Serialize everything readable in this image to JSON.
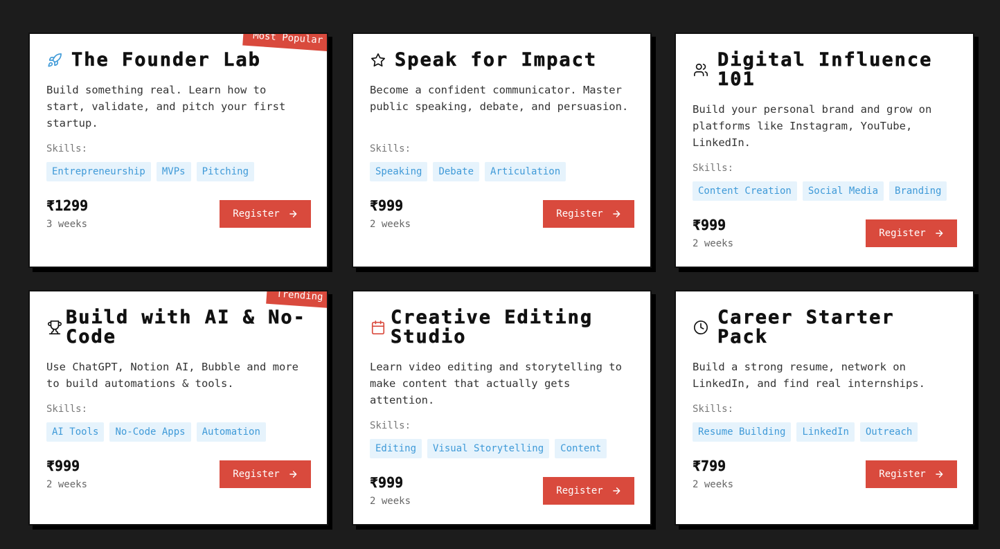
{
  "colors": {
    "accent": "#d94a3d",
    "tag_bg": "#e6f3fc",
    "tag_text": "#3f9ad8",
    "background": "#1c1c1c"
  },
  "skills_label": "Skills:",
  "register_label": "Register",
  "courses": [
    {
      "title": "The Founder Lab",
      "icon": "rocket-icon",
      "ribbon": "Most Popular",
      "description": "Build something real. Learn how to start, validate, and pitch your first startup.",
      "skills": [
        "Entrepreneurship",
        "MVPs",
        "Pitching"
      ],
      "price": "₹1299",
      "duration": "3 weeks"
    },
    {
      "title": "Speak for Impact",
      "icon": "star-icon",
      "description": "Become a confident communicator. Master public speaking, debate, and persuasion.",
      "skills": [
        "Speaking",
        "Debate",
        "Articulation"
      ],
      "price": "₹999",
      "duration": "2 weeks"
    },
    {
      "title": "Digital Influence 101",
      "icon": "users-icon",
      "description": "Build your personal brand and grow on platforms like Instagram, YouTube, LinkedIn.",
      "skills": [
        "Content Creation",
        "Social Media",
        "Branding"
      ],
      "price": "₹999",
      "duration": "2 weeks"
    },
    {
      "title": "Build with AI & No-Code",
      "icon": "trophy-icon",
      "ribbon": "Trending",
      "description": "Use ChatGPT, Notion AI, Bubble and more to build automations & tools.",
      "skills": [
        "AI Tools",
        "No-Code Apps",
        "Automation"
      ],
      "price": "₹999",
      "duration": "2 weeks"
    },
    {
      "title": "Creative Editing Studio",
      "icon": "calendar-icon",
      "description": "Learn video editing and storytelling to make content that actually gets attention.",
      "skills": [
        "Editing",
        "Visual Storytelling",
        "Content"
      ],
      "price": "₹999",
      "duration": "2 weeks"
    },
    {
      "title": "Career Starter Pack",
      "icon": "clock-icon",
      "description": "Build a strong resume, network on LinkedIn, and find real internships.",
      "skills": [
        "Resume Building",
        "LinkedIn",
        "Outreach"
      ],
      "price": "₹799",
      "duration": "2 weeks"
    }
  ]
}
